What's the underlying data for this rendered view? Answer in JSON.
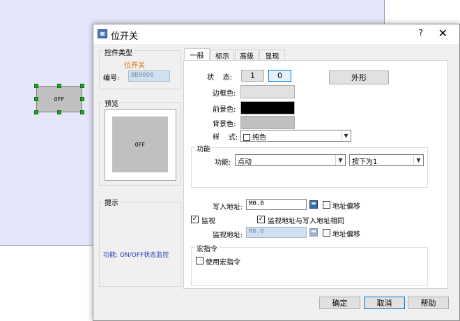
{
  "canvas": {
    "widget_label": "OFF"
  },
  "dialog": {
    "title": "位开关",
    "help_label": "?",
    "close_label": "✕",
    "left": {
      "type_group_title": "控件类型",
      "type_value": "位开关",
      "id_label": "编号:",
      "id_value": "BB0000",
      "preview_title": "预览",
      "preview_label": "OFF",
      "hint_title": "提示",
      "hint_text": "功能: ON/OFF状态监控"
    },
    "tabs": [
      "一般",
      "标示",
      "高级",
      "显现"
    ],
    "general": {
      "state_label": "状    态:",
      "state_buttons": [
        "1",
        "0"
      ],
      "shape_button": "外形",
      "border_color_label": "边框色:",
      "fg_color_label": "前景色:",
      "bg_color_label": "背景色:",
      "style_label": "样    式:",
      "style_value": "纯色",
      "colors": {
        "border": "#e1e1e1",
        "foreground": "#000000",
        "background": "#c0c0c0"
      },
      "function_group_title": "功能",
      "function_label": "功能:",
      "function_value": "点动",
      "press_value": "按下为1",
      "write_addr_label": "写入地址:",
      "write_addr_value": "M0.0",
      "addr_offset_label": "地址偏移",
      "monitor_label": "监视",
      "monitor_same_label": "监视地址与写入地址相同",
      "monitor_addr_label": "监视地址:",
      "monitor_addr_value": "M0.0",
      "monitor_offset_label": "地址偏移",
      "macro_group_title": "宏指令",
      "use_macro_label": "使用宏指令"
    },
    "footer": {
      "ok": "确定",
      "cancel": "取消",
      "help": "帮助"
    }
  }
}
